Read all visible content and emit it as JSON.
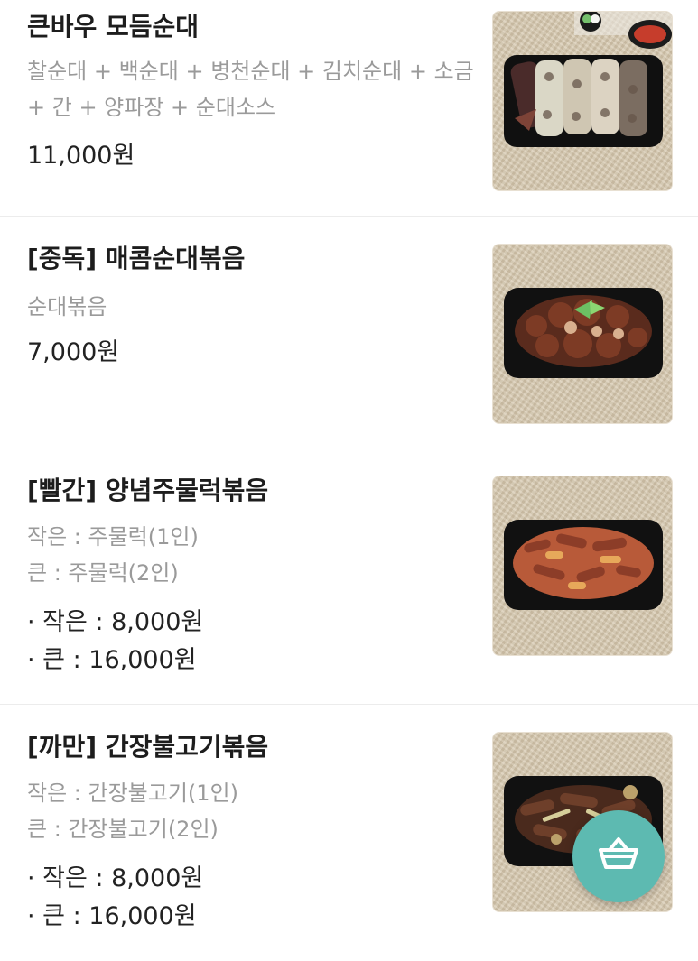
{
  "menu": {
    "items": [
      {
        "name": "큰바우 모듬순대",
        "description_lines": [
          "찰순대 + 백순대 + 병천순대 + 김치순대 + 소금",
          "+ 간 + 양파장 + 순대소스"
        ],
        "price_lines": [
          "11,000원"
        ],
        "image_icon": "sundae-platter-photo"
      },
      {
        "name": "[중독] 매콤순대볶음",
        "description_lines": [
          "순대볶음"
        ],
        "price_lines": [
          "7,000원"
        ],
        "image_icon": "spicy-stir-fry-photo"
      },
      {
        "name": "[빨간] 양념주물럭볶음",
        "description_lines": [
          "작은 : 주물럭(1인)",
          "큰 : 주물럭(2인)"
        ],
        "price_lines": [
          "· 작은 : 8,000원",
          "· 큰 : 16,000원"
        ],
        "image_icon": "red-jumulleok-photo"
      },
      {
        "name": "[까만] 간장불고기볶음",
        "description_lines": [
          "작은 : 간장불고기(1인)",
          "큰 : 간장불고기(2인)"
        ],
        "price_lines": [
          "· 작은 : 8,000원",
          "· 큰 : 16,000원"
        ],
        "image_icon": "soy-bulgogi-photo"
      }
    ]
  },
  "floating_cart": {
    "icon": "shopping-basket-icon",
    "color": "#5dbab1"
  },
  "colors": {
    "title": "#1d1d1d",
    "description": "#9a9a9a",
    "divider": "#ececec"
  }
}
